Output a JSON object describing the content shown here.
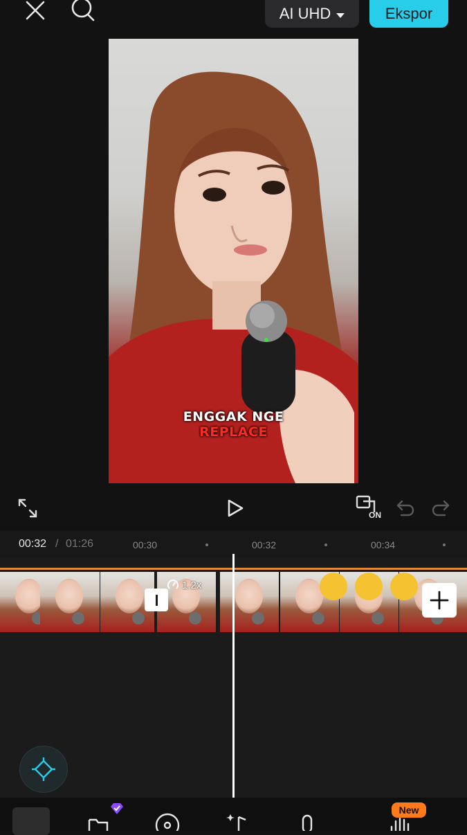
{
  "topbar": {
    "quality_label": "AI UHD",
    "export_label": "Ekspor"
  },
  "preview": {
    "caption_line1": "ENGGAK NGE",
    "caption_line2": "REPLACE"
  },
  "controls": {
    "overlay_toggle_label": "ON"
  },
  "timeline": {
    "current_time": "00:32",
    "separator": "/",
    "total_time": "01:26",
    "ticks": [
      "00:30",
      "00:32",
      "00:34"
    ],
    "speed_label": "1.2x"
  },
  "bottom_tabs": {
    "new_badge": "New"
  },
  "colors": {
    "accent": "#27cde9",
    "badge": "#ff7a1a",
    "clip_border": "#e08a3a"
  }
}
